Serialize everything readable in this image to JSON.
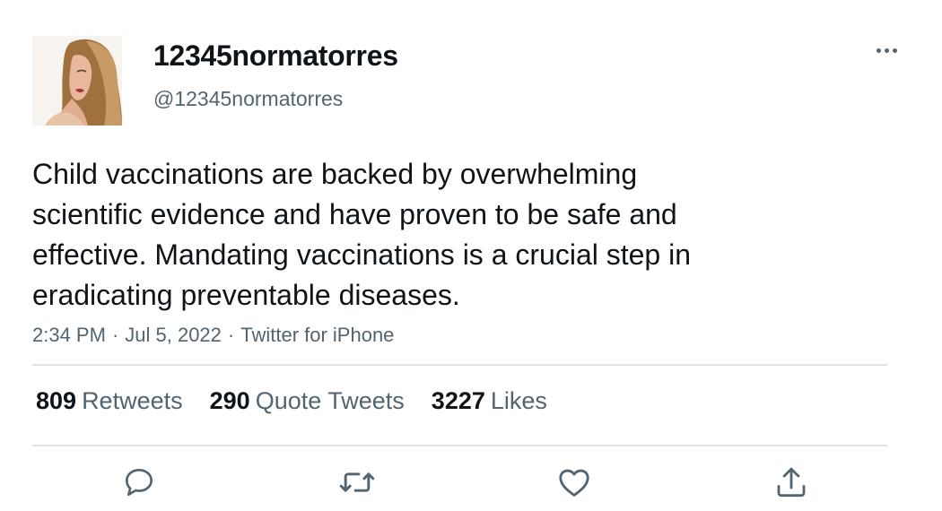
{
  "user": {
    "display_name": "12345normatorres",
    "handle": "@12345normatorres",
    "avatar_icon": "profile-photo"
  },
  "tweet": {
    "text_lines": [
      "Child vaccinations are backed by overwhelming",
      "scientific evidence and have proven to be safe and",
      "effective. Mandating vaccinations is a crucial step in",
      "eradicating preventable diseases."
    ],
    "time": "2:34 PM",
    "date": "Jul 5, 2022",
    "source": "Twitter for iPhone",
    "separator": "·"
  },
  "stats": {
    "retweets_count": "809",
    "retweets_label": "Retweets",
    "quotes_count": "290",
    "quotes_label": "Quote Tweets",
    "likes_count": "3227",
    "likes_label": "Likes"
  },
  "actions": [
    "reply-icon",
    "retweet-icon",
    "like-icon",
    "share-icon"
  ],
  "colors": {
    "text_primary": "#0f1419",
    "text_secondary": "#536471",
    "divider": "#dfe3e6"
  }
}
